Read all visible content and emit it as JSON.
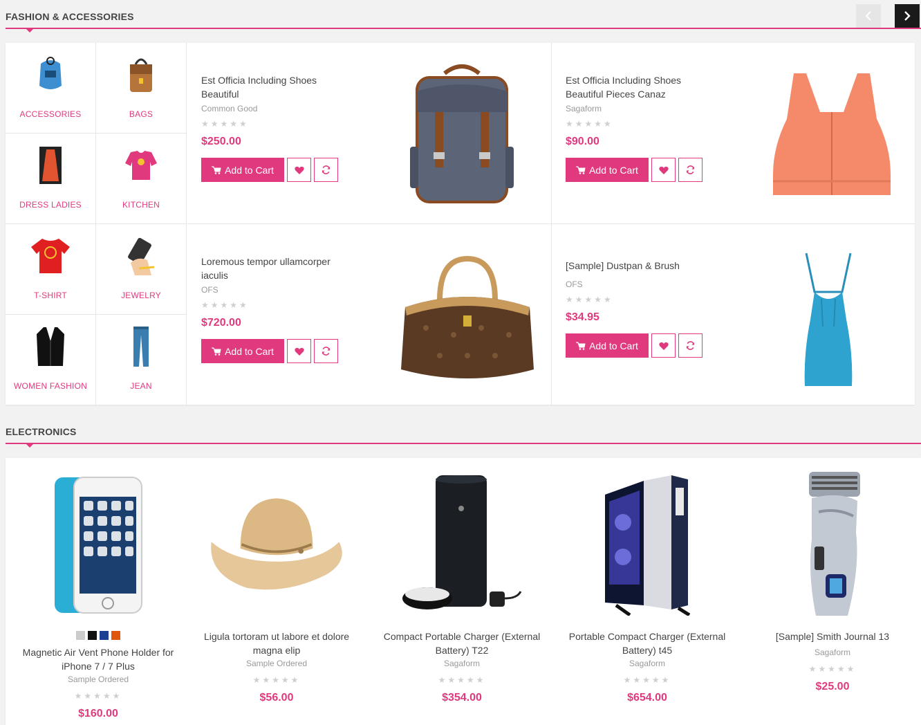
{
  "fashion": {
    "title": "FASHION & ACCESSORIES",
    "categories": [
      {
        "label": "ACCESSORIES",
        "icon": "accessory-icon"
      },
      {
        "label": "BAGS",
        "icon": "bag-icon"
      },
      {
        "label": "DRESS LADIES",
        "icon": "dress-icon"
      },
      {
        "label": "KITCHEN",
        "icon": "kitchen-icon"
      },
      {
        "label": "T-SHIRT",
        "icon": "tshirt-icon"
      },
      {
        "label": "JEWELRY",
        "icon": "jewelry-icon"
      },
      {
        "label": "WOMEN FASHION",
        "icon": "women-fashion-icon"
      },
      {
        "label": "JEAN",
        "icon": "jean-icon"
      }
    ],
    "products": [
      {
        "title": "Est Officia Including Shoes Beautiful",
        "brand": "Common Good",
        "price": "$250.00",
        "rating": 0,
        "stars": "★★★★★",
        "cart_label": "Add to Cart",
        "image": "backpack"
      },
      {
        "title": "Est Officia Including Shoes Beautiful Pieces Canaz",
        "brand": "Sagaform",
        "price": "$90.00",
        "rating": 0,
        "stars": "★★★★★",
        "cart_label": "Add to Cart",
        "image": "sports-bra"
      },
      {
        "title": "Loremous tempor ullamcorper iaculis",
        "brand": "OFS",
        "price": "$720.00",
        "rating": 0,
        "stars": "★★★★★",
        "cart_label": "Add to Cart",
        "image": "handbag"
      },
      {
        "title": "[Sample] Dustpan & Brush",
        "brand": "OFS",
        "price": "$34.95",
        "rating": 0,
        "stars": "★★★★★",
        "cart_label": "Add to Cart",
        "image": "tank-top"
      }
    ]
  },
  "electronics": {
    "title": "ELECTRONICS",
    "products": [
      {
        "title": "Magnetic Air Vent Phone Holder for iPhone 7 / 7 Plus",
        "brand": "Sample Ordered",
        "price": "$160.00",
        "rating": 0,
        "stars": "★★★★★",
        "image": "phone",
        "swatches": [
          "#cccccc",
          "#111111",
          "#1c3f94",
          "#e0560c"
        ]
      },
      {
        "title": "Ligula tortoram ut labore et dolore magna elip",
        "brand": "Sample Ordered",
        "price": "$56.00",
        "rating": 0,
        "stars": "★★★★★",
        "image": "straw-hat"
      },
      {
        "title": "Compact Portable Charger (External Battery) T22",
        "brand": "Sagaform",
        "price": "$354.00",
        "rating": 0,
        "stars": "★★★★★",
        "image": "smart-speaker"
      },
      {
        "title": "Portable Compact Charger (External Battery) t45",
        "brand": "Sagaform",
        "price": "$654.00",
        "rating": 0,
        "stars": "★★★★★",
        "image": "pc-tower"
      },
      {
        "title": "[Sample] Smith Journal 13",
        "brand": "Sagaform",
        "price": "$25.00",
        "rating": 0,
        "stars": "★★★★★",
        "image": "shaver"
      }
    ]
  },
  "colors": {
    "accent": "#e0397e",
    "text": "#444444",
    "muted": "#999999",
    "star": "#cfcfcf"
  }
}
